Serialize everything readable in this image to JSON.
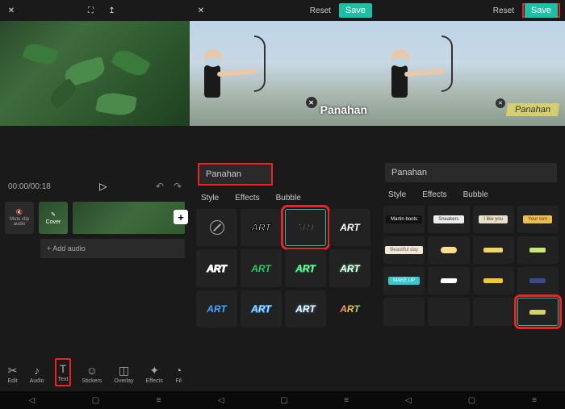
{
  "header": {
    "reset": "Reset",
    "save": "Save"
  },
  "panel1": {
    "time": "00:00/00:18",
    "mute_label": "Mute clip audio",
    "cover_label": "Cover",
    "add_audio": "+  Add audio",
    "tools": {
      "edit": "Edit",
      "audio": "Audio",
      "text": "Text",
      "stickers": "Stickers",
      "overlay": "Overlay",
      "effects": "Effects",
      "filter": "Fil"
    }
  },
  "text_panel": {
    "input_value": "Panahan",
    "tabs": {
      "style": "Style",
      "effects": "Effects",
      "bubble": "Bubble"
    },
    "style_label": "ART",
    "bubbles": [
      [
        "Martin boots",
        "Sneakers",
        "I like you",
        "Your turn"
      ],
      [
        "Beautiful day",
        "",
        "",
        ""
      ],
      [
        "MAKE UP",
        "",
        "",
        ""
      ],
      [
        "",
        "",
        "",
        ""
      ]
    ]
  },
  "preview": {
    "caption": "Panahan"
  },
  "colors": {
    "accent": "#1fbfa5",
    "highlight": "#e22222"
  }
}
